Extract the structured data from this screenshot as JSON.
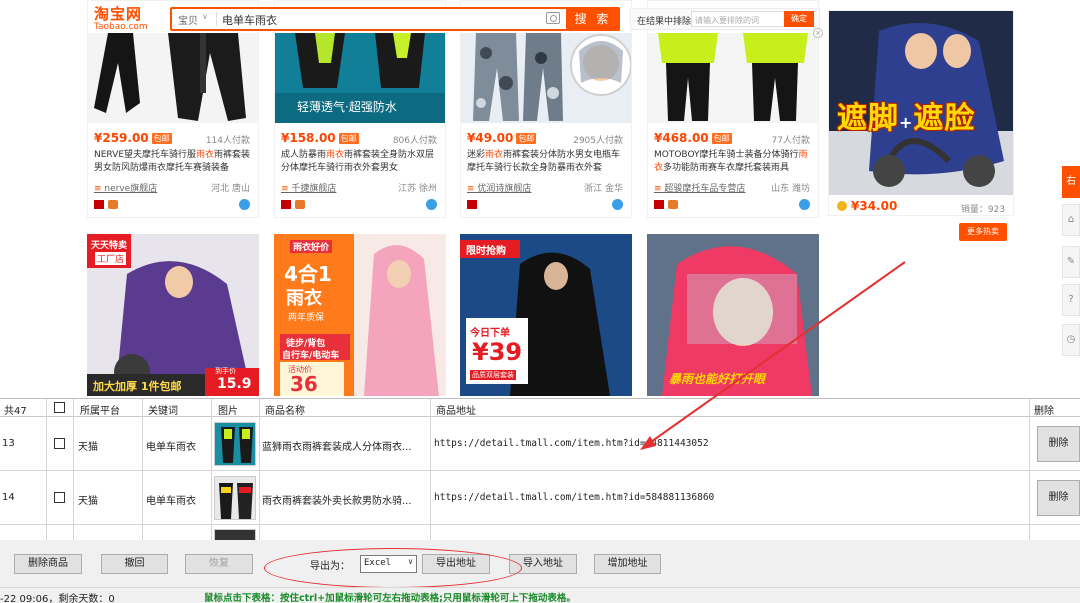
{
  "taobao": {
    "logo_cn": "淘宝网",
    "logo_en": "Taobao.com",
    "search_category": "宝贝",
    "search_query": "电单车雨衣",
    "search_button": "搜 索",
    "filter_label": "在结果中排除",
    "filter_placeholder": "请输入要排除的词",
    "filter_ok": "确定",
    "close_mark": "×",
    "products": [
      {
        "price": "¥259.00",
        "badge": "包邮",
        "sales": "114人付款",
        "title_pre": "NERVE望夫摩托车骑行服",
        "title_hl": "雨衣",
        "title_post": "雨裤套装男女防风防爆雨衣摩托车赛骑装备",
        "shop": "nerve旗舰店",
        "location": "河北 唐山"
      },
      {
        "price": "¥158.00",
        "badge": "包邮",
        "sales": "806人付款",
        "title_pre": "成人防暴雨",
        "title_hl": "雨衣",
        "title_post": "雨裤套装全身防水双层分体摩托车骑行雨衣外套男女",
        "shop": "千捷旗舰店",
        "location": "江苏 徐州"
      },
      {
        "price": "¥49.00",
        "badge": "包邮",
        "sales": "2905人付款",
        "title_pre": "迷彩",
        "title_hl": "雨衣",
        "title_post": "雨裤套装分体防水男女电瓶车摩托车骑行长款全身防暴雨衣外套",
        "shop": "优润诗旗舰店",
        "location": "浙江 金华"
      },
      {
        "price": "¥468.00",
        "badge": "包邮",
        "sales": "77人付款",
        "title_pre": "MOTOBOY摩托车骑士装备分体骑行",
        "title_hl": "雨衣",
        "title_post": "多功能防雨赛车衣摩托套装雨具",
        "shop": "超骏摩托车品专营店",
        "location": "山东 潍坊"
      }
    ],
    "ad": {
      "headline_a": "遮脚",
      "headline_plus": "+",
      "headline_b": "遮脸",
      "price": "¥34.00",
      "sold": "销量：923",
      "more_button": "更多热卖"
    },
    "side_tabs": [
      "右",
      "⌂",
      "✎",
      "?",
      "◷"
    ],
    "row2_cards": [
      {
        "badge_top": "天天特卖",
        "badge_sub": "工厂店",
        "bottom_left": "加大加厚 1件包邮",
        "price_tag": "15.9",
        "price_label": "到手价"
      },
      {
        "top_tag": "雨衣好价",
        "big_text": "4合1",
        "big_text2": "雨衣",
        "sub1": "两年质保",
        "sub2": "徒步/背包",
        "sub3": "自行车/电动车",
        "promo": "活动价",
        "promo_price": "36"
      },
      {
        "top_tag": "限时抢购",
        "today": "今日下单",
        "price": "¥39",
        "sub": "品质双层套装"
      },
      {
        "bottom": "暴雨也能好打开眼"
      }
    ]
  },
  "grid": {
    "headers": {
      "count": "共47",
      "platform": "所属平台",
      "keyword": "关键词",
      "image": "图片",
      "name": "商品名称",
      "url": "商品地址",
      "delete": "删除"
    },
    "rows": [
      {
        "index": "13",
        "platform": "天猫",
        "keyword": "电单车雨衣",
        "name": "蓝狮雨衣雨裤套装成人分体雨衣...",
        "url": "https://detail.tmall.com/item.htm?id=44811443052",
        "delete": "删除"
      },
      {
        "index": "14",
        "platform": "天猫",
        "keyword": "电单车雨衣",
        "name": "雨衣雨裤套装外卖长款男防水骑...",
        "url": "https://detail.tmall.com/item.htm?id=584881136860",
        "delete": "删除"
      }
    ]
  },
  "toolbar": {
    "delete_goods": "删除商品",
    "undo": "撤回",
    "restore": "恢复",
    "export_label": "导出为：",
    "export_format": "Excel",
    "export_address": "导出地址",
    "import_address": "导入地址",
    "add_address": "增加地址"
  },
  "status": {
    "left": "-22 09:06，剩余天数：0",
    "hint": "鼠标点击下表格：按住ctrl+加鼠标滑轮可左右拖动表格;只用鼠标滑轮可上下拖动表格。"
  },
  "colors": {
    "taobao_orange": "#ff5000",
    "price_red": "#ff4400",
    "annotation_red": "#e53030",
    "hint_green": "#1b8a2a"
  }
}
